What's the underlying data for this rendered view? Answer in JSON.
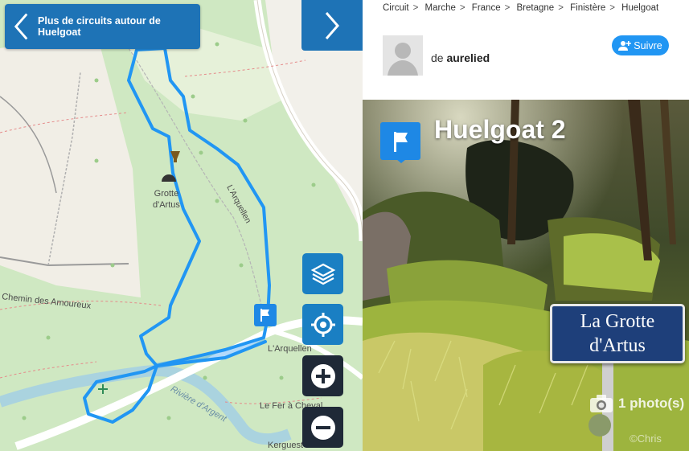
{
  "map": {
    "back_button_label": "Plus de circuits autour de Huelgoat",
    "labels": {
      "grotte": "Grotte\nd'Artus",
      "arquellen_road": "L'Arquellen",
      "chemin": "Chemin des Amoureux",
      "arquellen_place": "L'Arquellen",
      "riviere": "Rivière d'Argent",
      "fer": "Le Fer à Cheval",
      "kerguest": "Kerguest"
    },
    "route_color": "#2196f3"
  },
  "breadcrumb": [
    "Circuit",
    "Marche",
    "France",
    "Bretagne",
    "Finistère",
    "Huelgoat"
  ],
  "author": {
    "prefix": "de",
    "name": "aurelied"
  },
  "follow_label": "Suivre",
  "photo": {
    "title": "Huelgoat 2",
    "sign_line1": "La Grotte",
    "sign_line2": "d'Artus",
    "count_label": "1 photo(s)",
    "watermark": "©Chris"
  }
}
